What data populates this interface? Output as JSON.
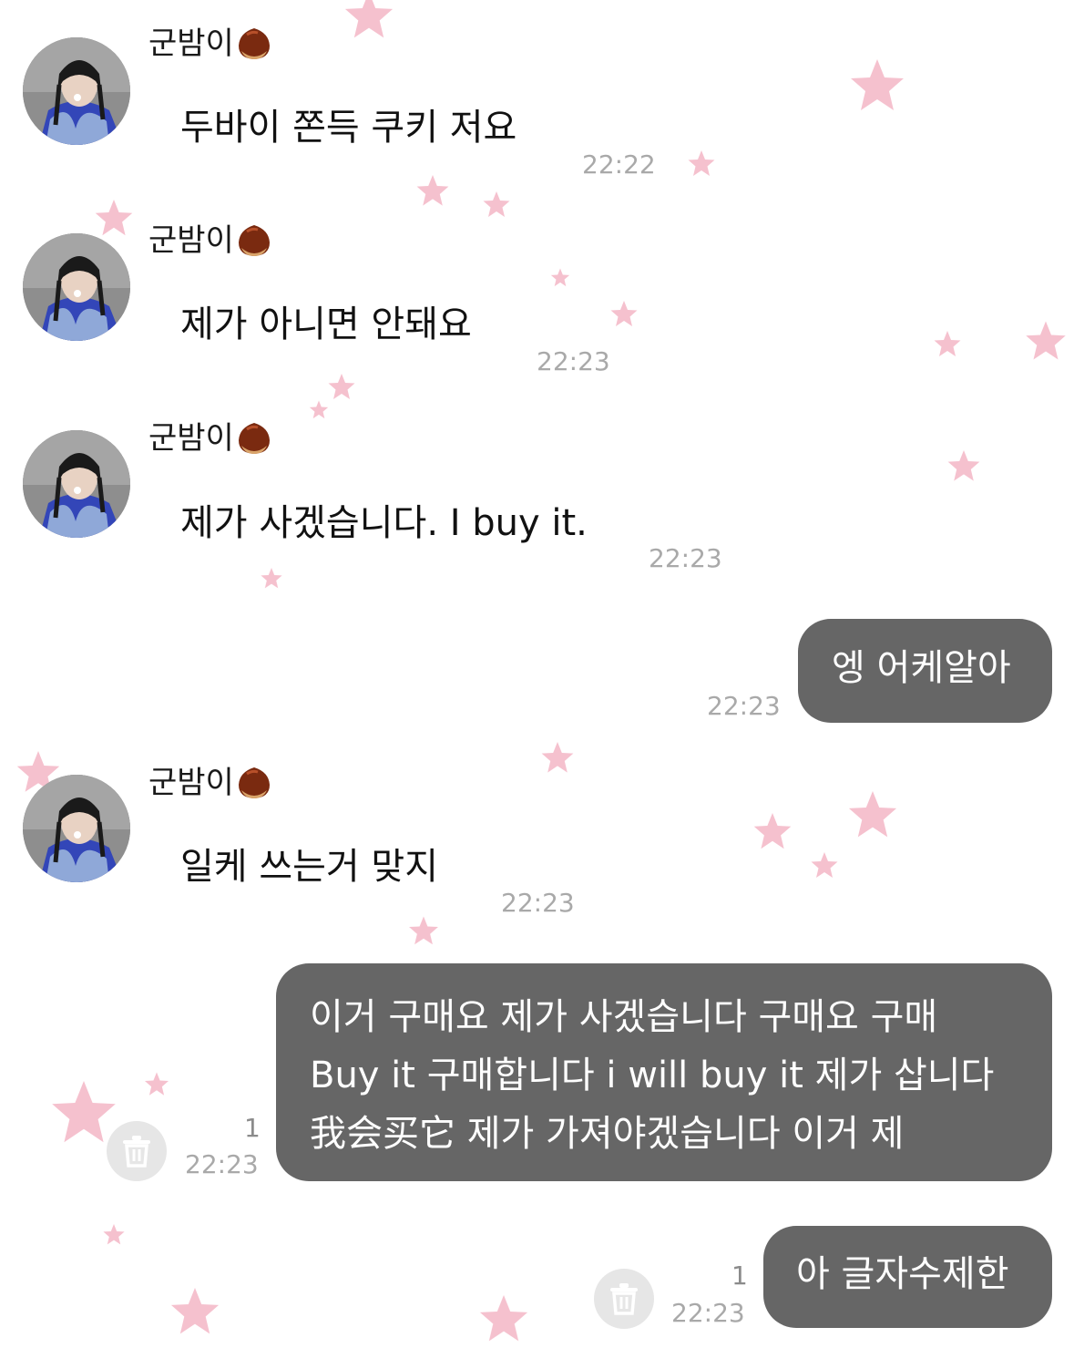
{
  "sender_name": "군밤이",
  "messages": [
    {
      "direction": "in",
      "text": "두바이 쫀득 쿠키 저요",
      "time": "22:22"
    },
    {
      "direction": "in",
      "text": "제가 아니면 안돼요",
      "time": "22:23"
    },
    {
      "direction": "in",
      "text": "제가 사겠습니다. I buy it.",
      "time": "22:23"
    },
    {
      "direction": "out",
      "text": "엥 어케알아",
      "time": "22:23"
    },
    {
      "direction": "in",
      "text": "일케 쓰는거 맞지",
      "time": "22:23"
    },
    {
      "direction": "out",
      "lines": [
        "이거 구매요 제가 사겠습니다 구매요 구매",
        "Buy it 구매합니다 i will buy it 제가 삽니다",
        "我会买它 제가 가져야겠습니다 이거 제"
      ],
      "time": "22:23",
      "unread": "1"
    },
    {
      "direction": "out",
      "text": "아 글자수제한",
      "time": "22:23",
      "unread": "1"
    }
  ],
  "colors": {
    "outgoing_bubble": "#666666",
    "time_text": "#a9a9a9",
    "star": "#f4b6c6"
  },
  "icons": {
    "sender_badge": "chestnut-emoji",
    "pending_action": "trash-icon"
  }
}
